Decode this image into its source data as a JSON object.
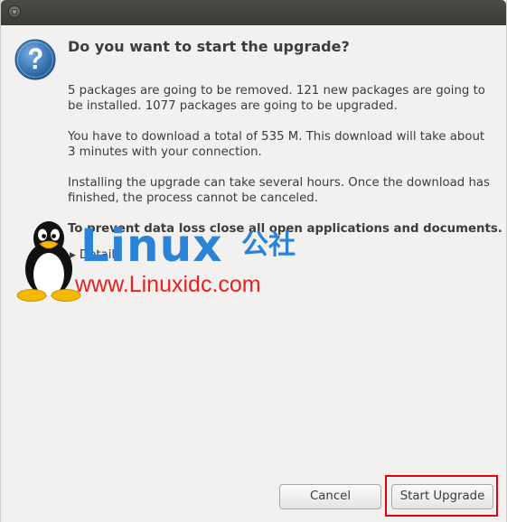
{
  "dialog": {
    "heading": "Do you want to start the upgrade?",
    "paragraphs": [
      "5 packages are going to be removed. 121 new packages are going to be installed. 1077 packages are going to be upgraded.",
      "You have to download a total of 535 M. This download will take about 3 minutes with your connection.",
      "Installing the upgrade can take several hours. Once the download has finished, the process cannot be canceled."
    ],
    "warning": "To prevent data loss close all open applications and documents.",
    "details_label": "Details"
  },
  "buttons": {
    "cancel": "Cancel",
    "start_upgrade": "Start Upgrade"
  },
  "icons": {
    "dialog_icon": "question-icon",
    "titlebar_close": "close-icon",
    "expander": "expander-arrow-icon"
  },
  "watermark": {
    "brand": "Linux",
    "brand_cn": "公社",
    "url": "www.Linuxidc.com"
  },
  "colors": {
    "question_icon": "#3f7bb8",
    "watermark_blue": "#2a83d6",
    "watermark_red": "#e8211d",
    "highlight_box": "#e3000f",
    "titlebar": "#3c3b37"
  }
}
